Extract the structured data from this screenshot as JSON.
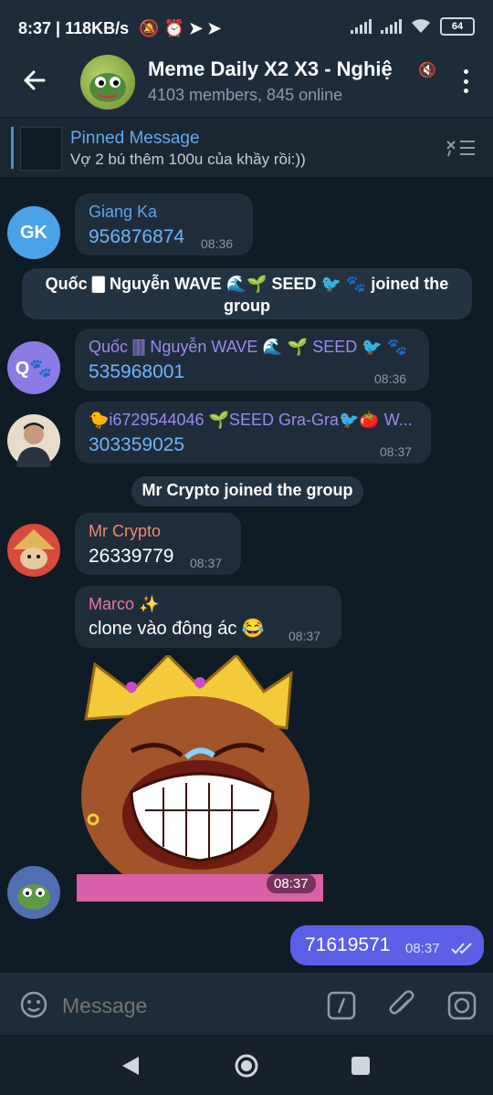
{
  "status_bar": {
    "time": "8:37",
    "speed": "| 118KB/s",
    "battery": "64"
  },
  "header": {
    "title": "Meme Daily X2 X3 - Nghiệ",
    "subtitle": "4103 members, 845 online"
  },
  "pinned": {
    "title": "Pinned Message",
    "text": "Vợ 2 bú thêm 100u của khầy rồi:))"
  },
  "messages": [
    {
      "avatar": "GK",
      "name": "Giang Ka",
      "text": "956876874",
      "time": "08:36"
    },
    {
      "system": "Quốc 🀫 Nguyễn WAVE 🌊 🌱 SEED 🐦 🐾 joined the group",
      "line1": "Quốc 🀫 Nguyễn WAVE 🌊🌱 SEED 🐦 🐾 joined the",
      "line2": "group"
    },
    {
      "avatar": "Q🐾",
      "name": "Quốc 🀫 Nguyễn WAVE 🌊 🌱 SEED 🐦 🐾",
      "text": "535968001",
      "time": "08:36"
    },
    {
      "name": "🐤i6729544046 🌱SEED Gra-Gra🐦🍅 W...",
      "text": "303359025",
      "time": "08:37"
    },
    {
      "system": "Mr Crypto joined the group"
    },
    {
      "name": "Mr Crypto",
      "text": "26339779",
      "time": "08:37"
    },
    {
      "name": "Marco ✨",
      "text": "clone vào đông ác 😂",
      "time": "08:37"
    },
    {
      "sticker_time": "08:37"
    },
    {
      "outgoing": "71619571",
      "time": "08:37"
    }
  ],
  "input": {
    "placeholder": "Message"
  },
  "colors": {
    "accent": "#5a5fe6",
    "link": "#70b5ff",
    "giang": "#5aa7e6",
    "quoc": "#9c8af0",
    "mrcrypto": "#f08a6c",
    "marco": "#e678a3"
  }
}
